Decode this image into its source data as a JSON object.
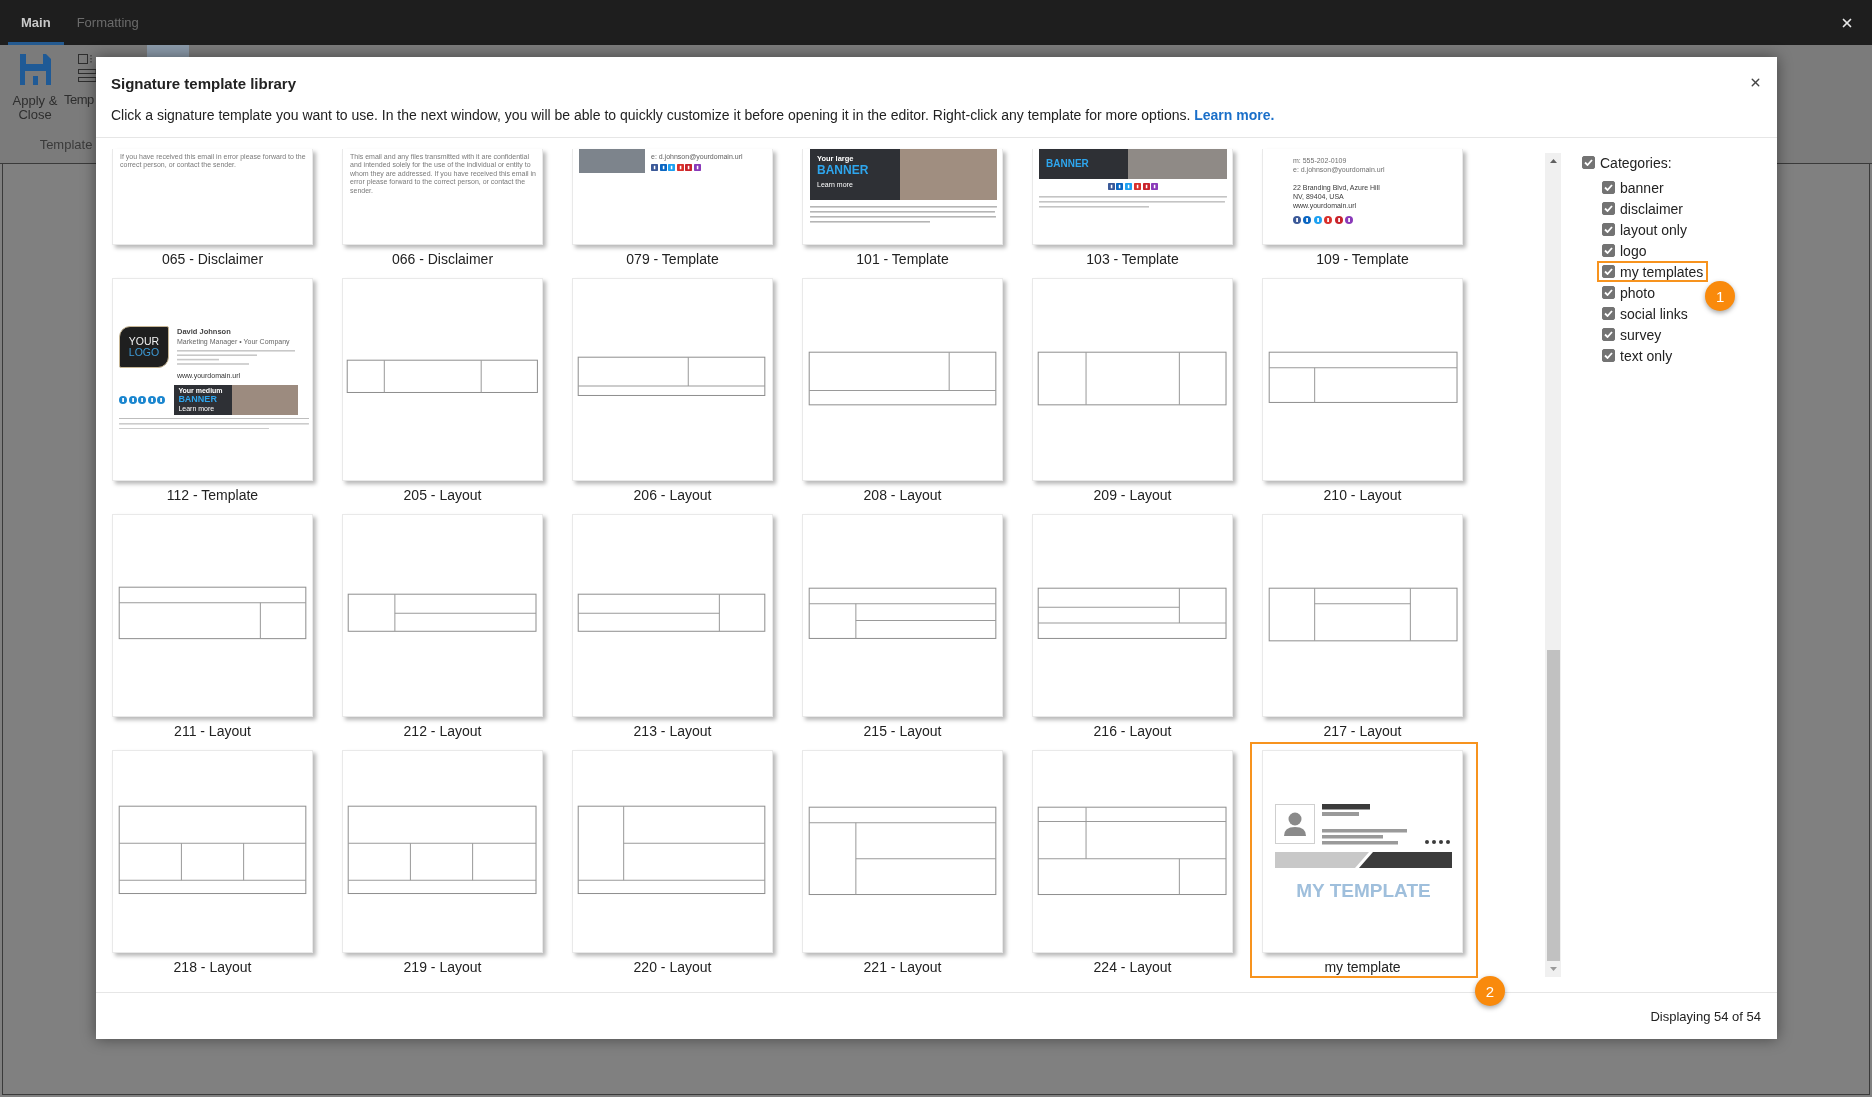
{
  "app_tabs": [
    {
      "label": "Main",
      "selected": true
    },
    {
      "label": "Formatting",
      "selected": false
    }
  ],
  "ribbon": {
    "buttons": [
      {
        "kind": "save",
        "label": "Apply & Close",
        "selected": false
      },
      {
        "kind": "template",
        "label": "Temp",
        "selected": false
      },
      {
        "kind": "blank",
        "selected": true
      }
    ],
    "group_label": "Template"
  },
  "dialog": {
    "title": "Signature template library",
    "description": "Click a signature template you want to use. In the next window, you will be able to quickly customize it before opening it in the editor. Right-click any template for more options.",
    "link": "Learn more.",
    "tiles": [
      {
        "label": "065 - Disclaimer",
        "kind": "disclaimer",
        "highlighted": false,
        "preview": {
          "text": "If you have received this email in error please forward to the correct person, or contact the sender."
        }
      },
      {
        "label": "066 - Disclaimer",
        "kind": "disclaimer",
        "highlighted": false,
        "preview": {
          "text": "This email and any files transmitted with it are confidential and intended solely for the use of the individual or entity to whom they are addressed. If you have received this email in error please forward to the correct person, or contact the sender."
        }
      },
      {
        "label": "079 - Template",
        "kind": "photo",
        "highlighted": false,
        "preview": {
          "email": "e: d.johnson@yourdomain.url"
        }
      },
      {
        "label": "101 - Template",
        "kind": "banner",
        "highlighted": false,
        "preview": {
          "heading": "Your large",
          "title": "BANNER",
          "link": "Learn more"
        }
      },
      {
        "label": "103 - Template",
        "kind": "banner-social",
        "highlighted": false,
        "preview": {
          "title": "BANNER"
        }
      },
      {
        "label": "109 - Template",
        "kind": "contact",
        "highlighted": false,
        "preview": {
          "phone": "m: 555-202-0109",
          "email": "e: d.johnson@yourdomain.url",
          "address": [
            "22 Branding Blvd, Azure Hill",
            "NV, 89404, USA"
          ],
          "website": "www.yourdomain.url"
        }
      },
      {
        "label": "112 - Template",
        "kind": "logo",
        "highlighted": false,
        "preview": {
          "logo_top": "YOUR",
          "logo_bottom": "LOGO",
          "name": "David Johnson",
          "position": "Marketing Manager • Your Company",
          "website": "www.yourdomain.url",
          "heading": "Your medium",
          "title": "BANNER",
          "link": "Learn more"
        }
      },
      {
        "label": "205 - Layout",
        "kind": "layout",
        "highlighted": false
      },
      {
        "label": "206 - Layout",
        "kind": "layout",
        "highlighted": false
      },
      {
        "label": "208 - Layout",
        "kind": "layout",
        "highlighted": false
      },
      {
        "label": "209 - Layout",
        "kind": "layout",
        "highlighted": false
      },
      {
        "label": "210 - Layout",
        "kind": "layout",
        "highlighted": false
      },
      {
        "label": "211 - Layout",
        "kind": "layout",
        "highlighted": false
      },
      {
        "label": "212 - Layout",
        "kind": "layout",
        "highlighted": false
      },
      {
        "label": "213 - Layout",
        "kind": "layout",
        "highlighted": false
      },
      {
        "label": "215 - Layout",
        "kind": "layout",
        "highlighted": false
      },
      {
        "label": "216 - Layout",
        "kind": "layout",
        "highlighted": false
      },
      {
        "label": "217 - Layout",
        "kind": "layout",
        "highlighted": false
      },
      {
        "label": "218 - Layout",
        "kind": "layout",
        "highlighted": false
      },
      {
        "label": "219 - Layout",
        "kind": "layout",
        "highlighted": false
      },
      {
        "label": "220 - Layout",
        "kind": "layout",
        "highlighted": false
      },
      {
        "label": "221 - Layout",
        "kind": "layout",
        "highlighted": false
      },
      {
        "label": "224 - Layout",
        "kind": "layout",
        "highlighted": false
      },
      {
        "label": "my template",
        "kind": "custom",
        "highlighted": true,
        "callout": "2",
        "preview": {
          "watermark": "MY TEMPLATE"
        }
      }
    ],
    "categories": {
      "label": "Categories:",
      "checked": true,
      "children": [
        {
          "label": "banner",
          "checked": true,
          "highlighted": false
        },
        {
          "label": "disclaimer",
          "checked": true,
          "highlighted": false
        },
        {
          "label": "layout only",
          "checked": true,
          "highlighted": false
        },
        {
          "label": "logo",
          "checked": true,
          "highlighted": false
        },
        {
          "label": "my templates",
          "checked": true,
          "highlighted": true,
          "callout": "1"
        },
        {
          "label": "photo",
          "checked": true,
          "highlighted": false
        },
        {
          "label": "social links",
          "checked": true,
          "highlighted": false
        },
        {
          "label": "survey",
          "checked": true,
          "highlighted": false
        },
        {
          "label": "text only",
          "checked": true,
          "highlighted": false
        }
      ]
    },
    "status": "Displaying 54 of 54"
  }
}
